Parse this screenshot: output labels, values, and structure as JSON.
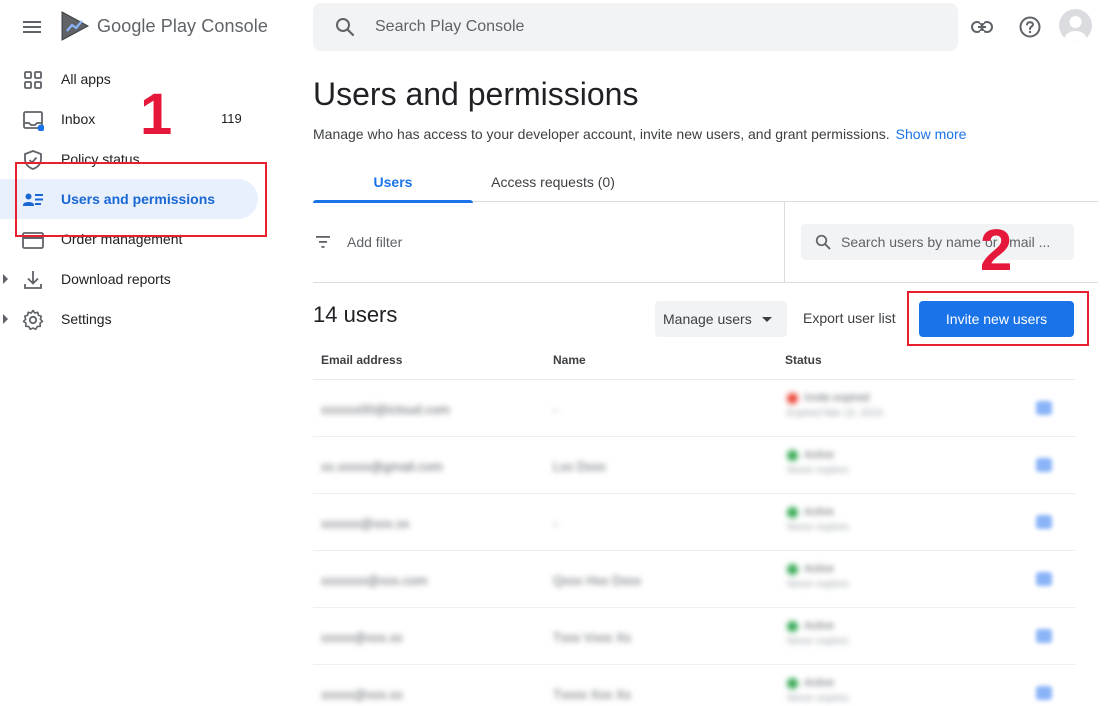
{
  "header": {
    "menu_icon": "hamburger-menu-icon",
    "app_title": "Google Play Console",
    "search_placeholder": "Search Play Console",
    "icons": [
      "link-icon",
      "help-icon",
      "account-avatar"
    ]
  },
  "sidebar": {
    "items": [
      {
        "label": "All apps",
        "icon": "apps-grid-icon"
      },
      {
        "label": "Inbox",
        "icon": "inbox-icon",
        "count": "119"
      },
      {
        "label": "Policy status",
        "icon": "shield-icon"
      },
      {
        "label": "Users and permissions",
        "icon": "people-list-icon",
        "active": true
      },
      {
        "label": "Order management",
        "icon": "credit-card-icon"
      },
      {
        "label": "Download reports",
        "icon": "download-icon"
      },
      {
        "label": "Settings",
        "icon": "gear-icon"
      }
    ]
  },
  "annotations": {
    "step1": "1",
    "step2": "2",
    "color": "#e5173a"
  },
  "main": {
    "title": "Users and permissions",
    "subtitle": "Manage who has access to your developer account, invite new users, and grant permissions.",
    "show_more": "Show more",
    "tabs": [
      {
        "label": "Users",
        "active": true
      },
      {
        "label": "Access requests (0)"
      }
    ],
    "add_filter": "Add filter",
    "user_search_placeholder": "Search users by name or email ...",
    "user_count": "14 users",
    "manage_users": "Manage users",
    "export_user_list": "Export user list",
    "invite_new_users": "Invite new users",
    "columns": [
      "Email address",
      "Name",
      "Status"
    ],
    "rows": [
      {
        "email": "xxxxxx00@icloud.com",
        "name": "-",
        "status": "Invite expired",
        "sub": "Expired Mar 10, 2023",
        "status_color": "#ea4335"
      },
      {
        "email": "xx.xxxxx@gmail.com",
        "name": "Lxx Dxxx",
        "status": "Active",
        "sub": "Never expires",
        "status_color": "#34a853"
      },
      {
        "email": "xxxxxx@xxx.xx",
        "name": "-",
        "status": "Active",
        "sub": "Never expires",
        "status_color": "#34a853"
      },
      {
        "email": "xxxxxxx@xxx.com",
        "name": "Qxxx Hxx Dxxx",
        "status": "Active",
        "sub": "Never expires",
        "status_color": "#34a853"
      },
      {
        "email": "xxxxx@xxx.xx",
        "name": "Txxx Vxxx Xx",
        "status": "Active",
        "sub": "Never expires",
        "status_color": "#34a853"
      },
      {
        "email": "xxxxx@xxx.xx",
        "name": "Txxxx Xxx Xx",
        "status": "Active",
        "sub": "Never expires",
        "status_color": "#34a853"
      }
    ]
  },
  "colors": {
    "accent": "#1a73e8",
    "active_bg": "#e8f0fe",
    "annotation": "#e8202e"
  }
}
